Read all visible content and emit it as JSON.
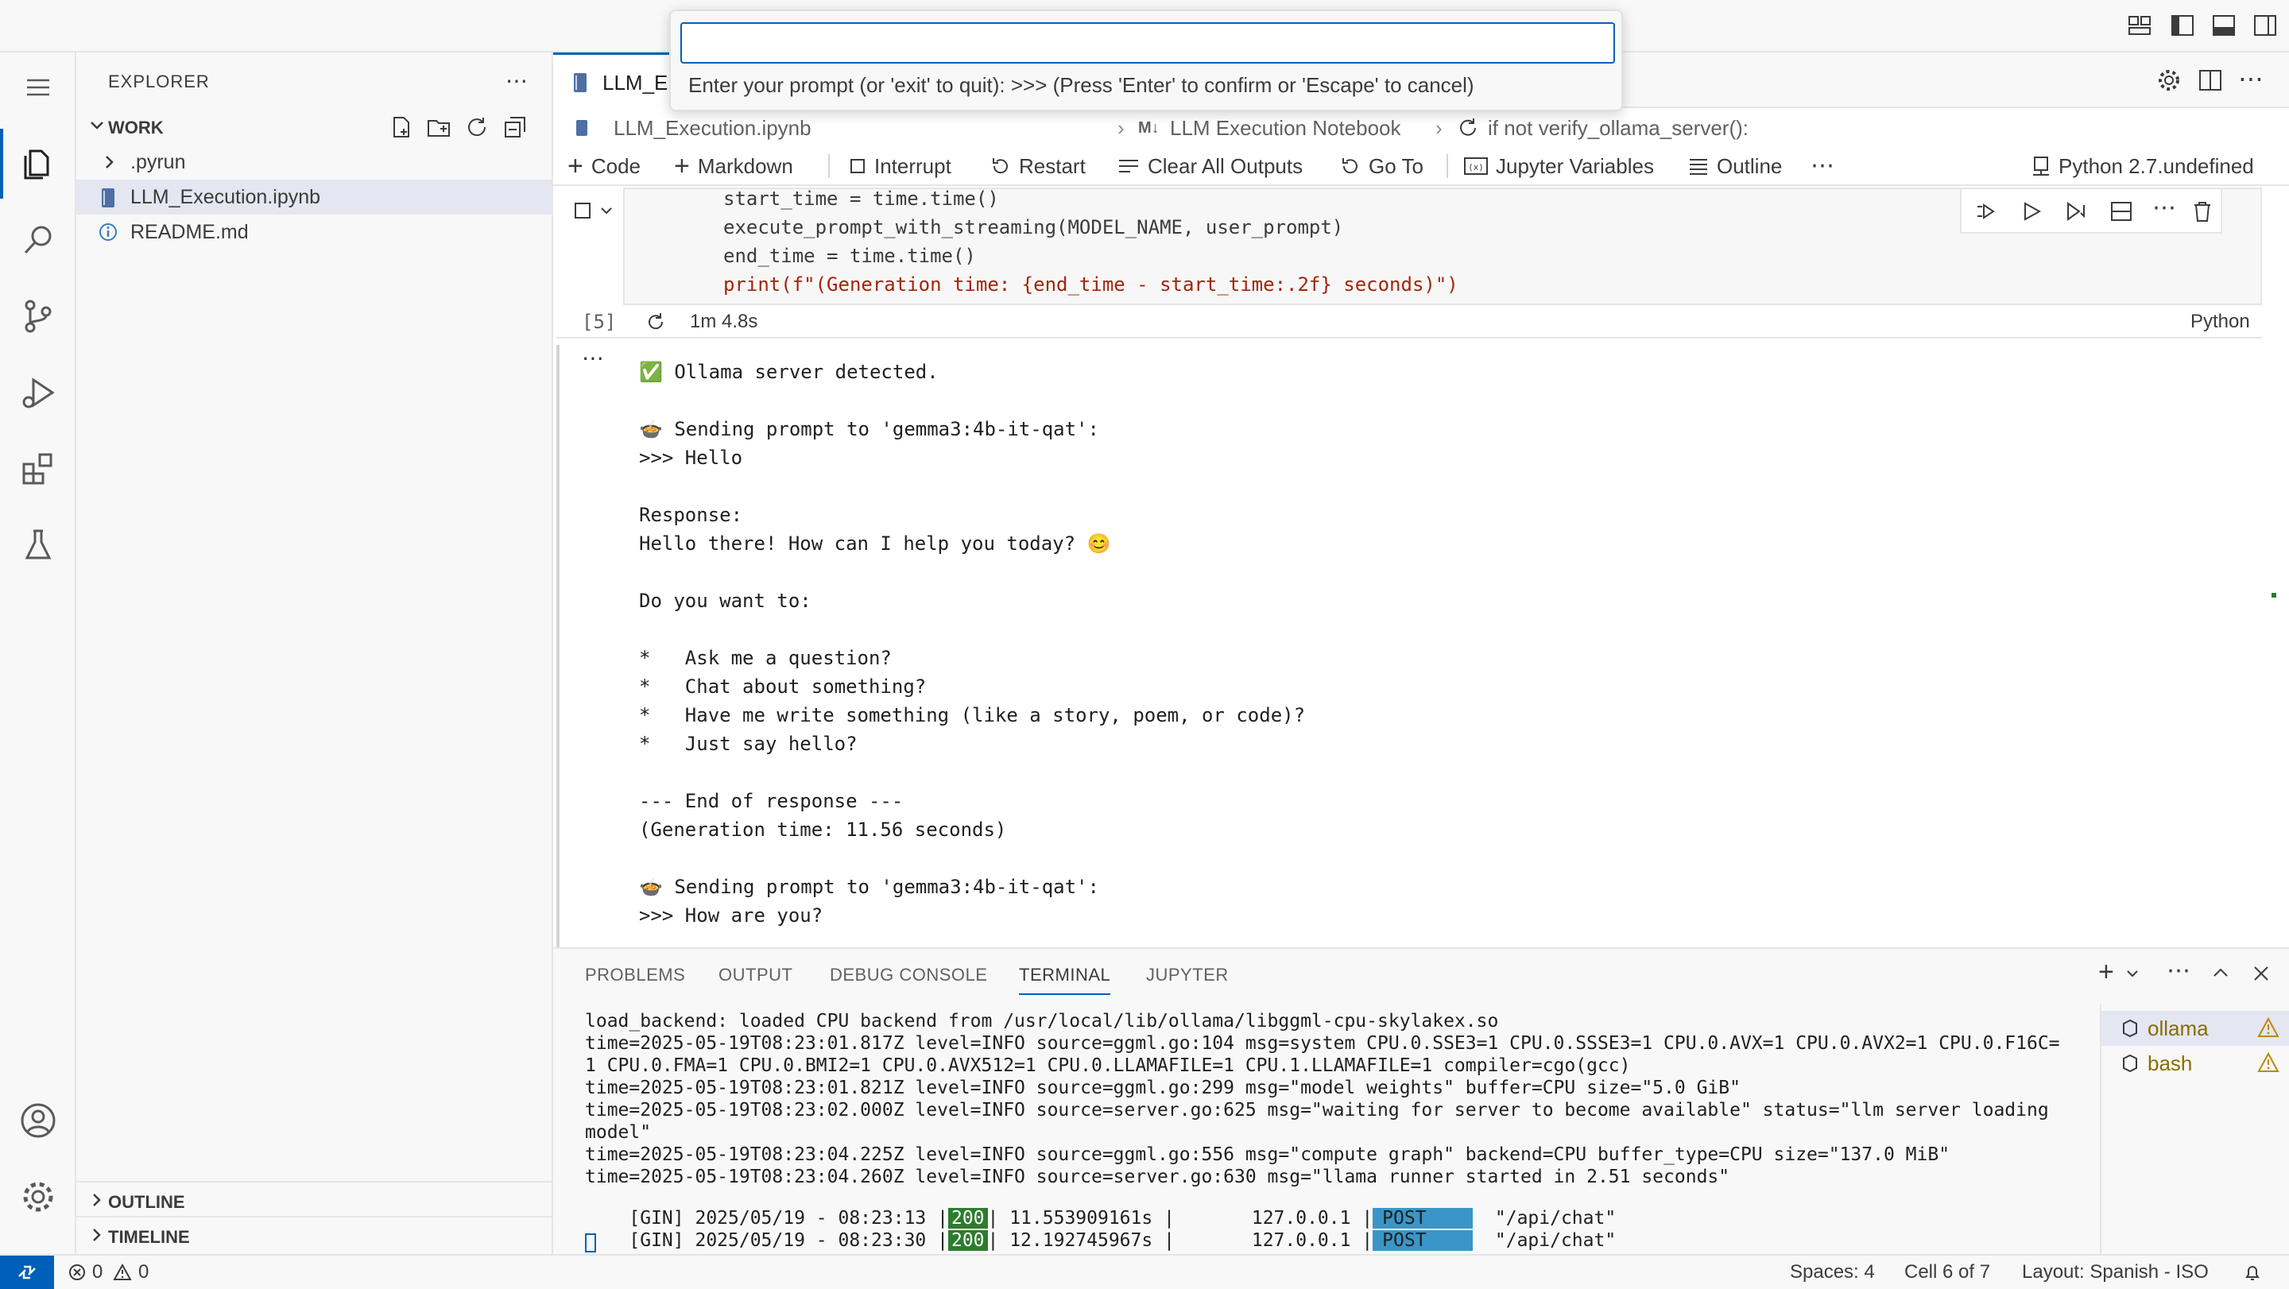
{
  "explorer": {
    "title": "EXPLORER",
    "folder": "WORK",
    "items": [
      {
        "name": ".pyrun",
        "type": "folder"
      },
      {
        "name": "LLM_Execution.ipynb",
        "type": "notebook"
      },
      {
        "name": "README.md",
        "type": "markdown"
      }
    ],
    "outline": "OUTLINE",
    "timeline": "TIMELINE"
  },
  "quick_input": {
    "value": "",
    "message": "Enter your prompt (or 'exit' to quit): >>> (Press 'Enter' to confirm or 'Escape' to cancel)"
  },
  "tab": {
    "label": "LLM_E"
  },
  "breadcrumb": {
    "file": "LLM_Execution.ipynb",
    "section": "LLM Execution Notebook",
    "symbol": "if not verify_ollama_server():"
  },
  "toolbar": {
    "code": "Code",
    "markdown": "Markdown",
    "interrupt": "Interrupt",
    "restart": "Restart",
    "clear": "Clear All Outputs",
    "goto": "Go To",
    "variables": "Jupyter Variables",
    "outline": "Outline",
    "kernel": "Python 2.7.undefined"
  },
  "cell": {
    "lines": [
      "start_time = time.time()",
      "execute_prompt_with_streaming(MODEL_NAME, user_prompt)",
      "end_time = time.time()",
      "print(f\"(Generation time: {end_time - start_time:.2f} seconds)\")"
    ],
    "exec_count": "[5]",
    "duration": "1m 4.8s",
    "language": "Python"
  },
  "output_lines": [
    "✅ Ollama server detected.",
    "",
    "🍲 Sending prompt to 'gemma3:4b-it-qat':",
    ">>> Hello",
    "",
    "Response:",
    "Hello there! How can I help you today? 😊",
    "",
    "Do you want to:",
    "",
    "*   Ask me a question?",
    "*   Chat about something?",
    "*   Have me write something (like a story, poem, or code)?",
    "*   Just say hello?",
    "",
    "--- End of response ---",
    "(Generation time: 11.56 seconds)",
    "",
    "🍲 Sending prompt to 'gemma3:4b-it-qat':",
    ">>> How are you?"
  ],
  "panel": {
    "tabs": [
      "PROBLEMS",
      "OUTPUT",
      "DEBUG CONSOLE",
      "TERMINAL",
      "JUPYTER"
    ],
    "active_tab": "TERMINAL",
    "terminal_lines": [
      "load_backend: loaded CPU backend from /usr/local/lib/ollama/libggml-cpu-skylakex.so",
      "time=2025-05-19T08:23:01.817Z level=INFO source=ggml.go:104 msg=system CPU.0.SSE3=1 CPU.0.SSSE3=1 CPU.0.AVX=1 CPU.0.AVX2=1 CPU.0.F16C=",
      "1 CPU.0.FMA=1 CPU.0.BMI2=1 CPU.0.AVX512=1 CPU.0.LLAMAFILE=1 CPU.1.LLAMAFILE=1 compiler=cgo(gcc)",
      "time=2025-05-19T08:23:01.821Z level=INFO source=ggml.go:299 msg=\"model weights\" buffer=CPU size=\"5.0 GiB\"",
      "time=2025-05-19T08:23:02.000Z level=INFO source=server.go:625 msg=\"waiting for server to become available\" status=\"llm server loading",
      "model\"",
      "time=2025-05-19T08:23:04.225Z level=INFO source=ggml.go:556 msg=\"compute graph\" backend=CPU buffer_type=CPU size=\"137.0 MiB\"",
      "time=2025-05-19T08:23:04.260Z level=INFO source=server.go:630 msg=\"llama runner started in 2.51 seconds\""
    ],
    "gin_lines": [
      {
        "prefix": "[GIN] 2025/05/19 - 08:23:13 |",
        "status": "200",
        "mid": "| 11.553909161s |       127.0.0.1 |",
        "method": "POST",
        "path": "\"/api/chat\""
      },
      {
        "prefix": "[GIN] 2025/05/19 - 08:23:30 |",
        "status": "200",
        "mid": "| 12.192745967s |       127.0.0.1 |",
        "method": "POST",
        "path": "\"/api/chat\""
      }
    ],
    "terminals": [
      "ollama",
      "bash"
    ]
  },
  "status": {
    "errors": "0",
    "warnings": "0",
    "spaces": "Spaces: 4",
    "cell": "Cell 6 of 7",
    "layout": "Layout: Spanish - ISO"
  },
  "colors": {
    "accent": "#005fb8",
    "status_ok": "#2d7d2d",
    "method_post": "#3a96c8"
  }
}
